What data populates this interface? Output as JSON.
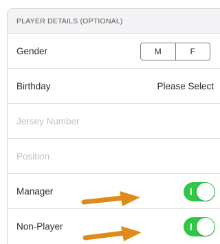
{
  "section": {
    "header": "PLAYER DETAILS (OPTIONAL)"
  },
  "gender": {
    "label": "Gender",
    "options": [
      "M",
      "F"
    ]
  },
  "birthday": {
    "label": "Birthday",
    "value": "Please Select"
  },
  "jersey": {
    "placeholder": "Jersey Number"
  },
  "position": {
    "placeholder": "Position"
  },
  "manager": {
    "label": "Manager",
    "toggle_on": true
  },
  "non_player": {
    "label": "Non-Player",
    "toggle_on": true
  },
  "colors": {
    "toggle_on": "#2fc746",
    "annotation_arrow": "#e08a1c",
    "placeholder_text": "#c2c2c8"
  },
  "icons": {
    "annotation": "right-arrow-icon"
  }
}
